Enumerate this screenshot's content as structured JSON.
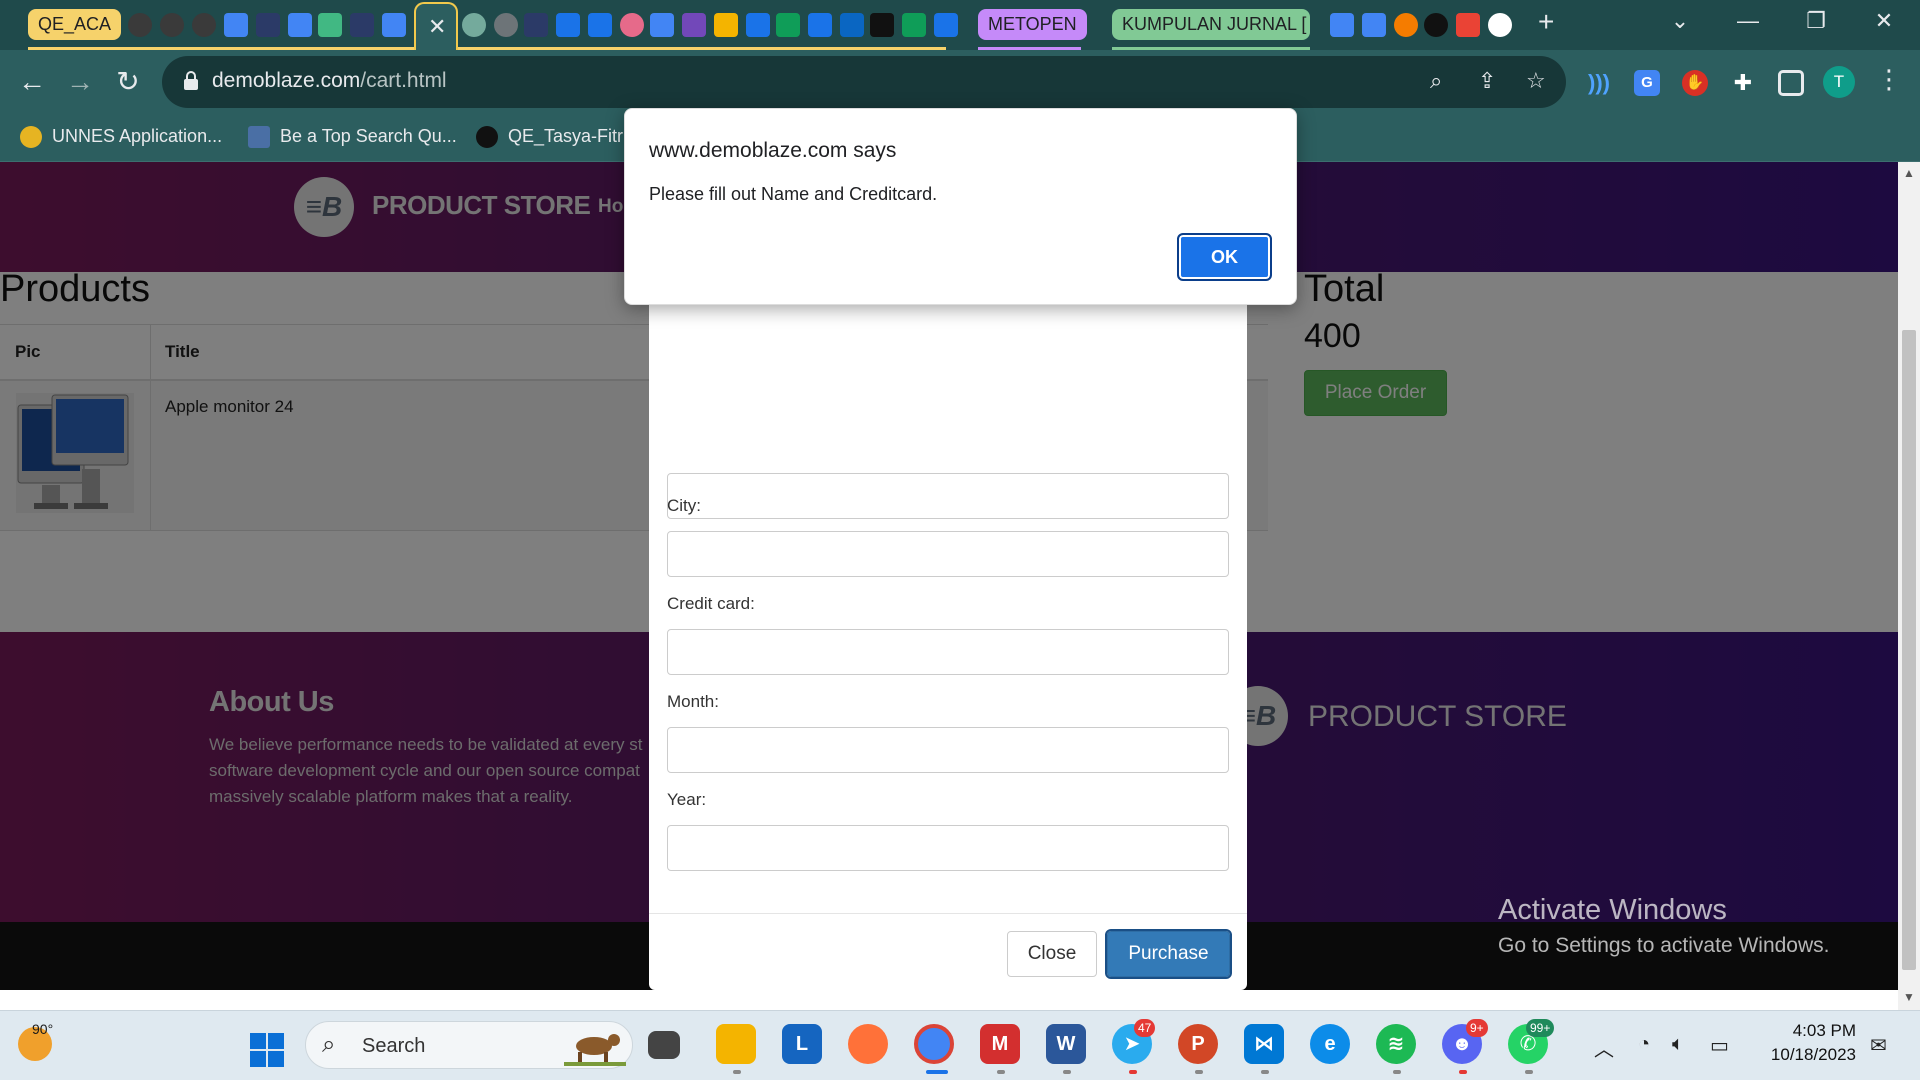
{
  "browser": {
    "tab_groups": [
      {
        "label": "QE_ACA",
        "color": "#f6d26b"
      },
      {
        "label": "METOPEN",
        "color": "#c58af9"
      },
      {
        "label": "KUMPULAN JURNAL [",
        "color": "#81c995"
      }
    ],
    "active_tab_close": "✕",
    "url_host": "demoblaze.com",
    "url_path": "/cart.html",
    "profile_initial": "T",
    "bookmarks": [
      "UNNES Application...",
      "Be a Top Search Qu...",
      "QE_Tasya-Fitria"
    ]
  },
  "site": {
    "brand_mark": "≡B",
    "brand": "PRODUCT STORE",
    "nav_home_partial": "Ho",
    "products_heading": "Products",
    "table_headers": [
      "Pic",
      "Title"
    ],
    "cart_rows": [
      {
        "title": "Apple monitor 24"
      }
    ],
    "total_heading": "Total",
    "total_value": "400",
    "place_order_label": "Place Order",
    "about_title": "About Us",
    "about_lines": [
      "We believe performance needs to be validated at every st",
      "software development cycle and our open source compat",
      "massively scalable platform makes that a reality."
    ],
    "footer_brand": "PRODUCT STORE"
  },
  "order_modal": {
    "labels": [
      "City:",
      "Credit card:",
      "Month:",
      "Year:"
    ],
    "close_label": "Close",
    "purchase_label": "Purchase"
  },
  "alert": {
    "title": "www.demoblaze.com says",
    "message": "Please fill out Name and Creditcard.",
    "ok_label": "OK"
  },
  "watermark": {
    "title": "Activate Windows",
    "subtitle": "Go to Settings to activate Windows."
  },
  "taskbar": {
    "weather_temp": "90°",
    "search_label": "Search",
    "badges": {
      "telegram": "47",
      "discord": "9+",
      "whatsapp": "99+"
    },
    "time": "4:03 PM",
    "date": "10/18/2023"
  }
}
